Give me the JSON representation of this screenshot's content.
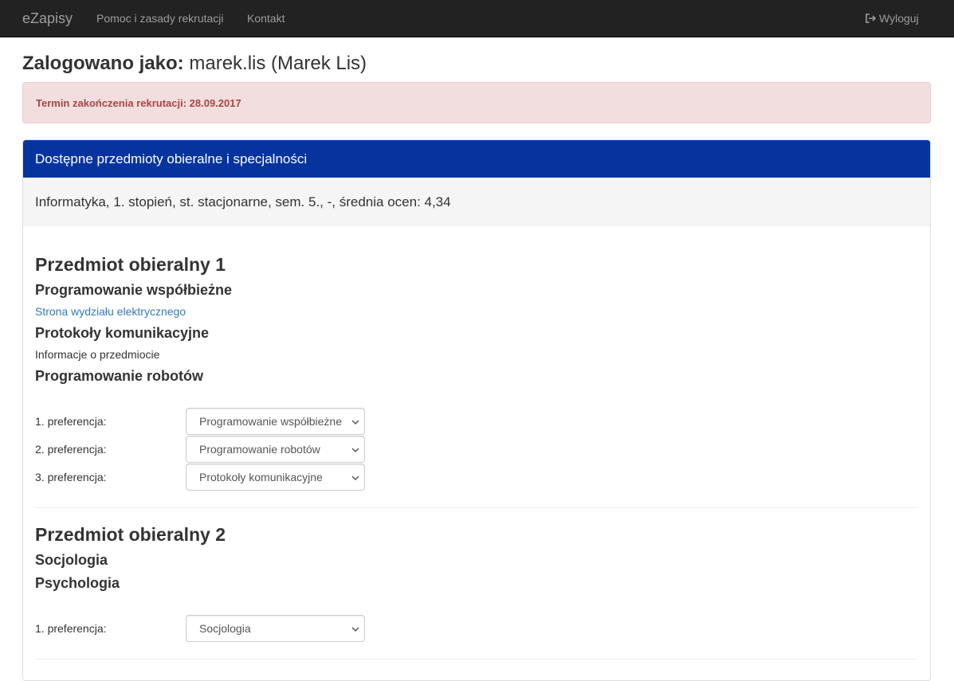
{
  "navbar": {
    "brand": "eZapisy",
    "links": [
      "Pomoc i zasady rekrutacji",
      "Kontakt"
    ],
    "logout_label": "Wyloguj",
    "background": "#222222"
  },
  "header": {
    "label": "Zalogowano jako:",
    "user": "marek.lis (Marek Lis)"
  },
  "alert": {
    "text": "Termin zakończenia rekrutacji: 28.09.2017",
    "color": "#a94442",
    "background": "#f2dede"
  },
  "panel": {
    "title": "Dostępne przedmioty obieralne i specjalności",
    "heading_color": "#06349e",
    "subtitle": "Informatyka, 1. stopień, st. stacjonarne, sem. 5., -, średnia ocen: 4,34"
  },
  "sections": [
    {
      "title": "Przedmiot obieralny 1",
      "courses": [
        {
          "name": "Programowanie współbieżne",
          "sub": "Strona wydziału elektrycznego",
          "sub_type": "link"
        },
        {
          "name": "Protokoły komunikacyjne",
          "sub": "Informacje o przedmiocie",
          "sub_type": "text"
        },
        {
          "name": "Programowanie robotów"
        }
      ],
      "preferences": [
        {
          "label": "1. preferencja:",
          "value": "Programowanie współbieżne"
        },
        {
          "label": "2. preferencja:",
          "value": "Programowanie robotów"
        },
        {
          "label": "3. preferencja:",
          "value": "Protokoły komunikacyjne"
        }
      ]
    },
    {
      "title": "Przedmiot obieralny 2",
      "courses": [
        {
          "name": "Socjologia"
        },
        {
          "name": "Psychologia"
        }
      ],
      "preferences": [
        {
          "label": "1. preferencja:",
          "value": "Socjologia"
        }
      ]
    }
  ]
}
